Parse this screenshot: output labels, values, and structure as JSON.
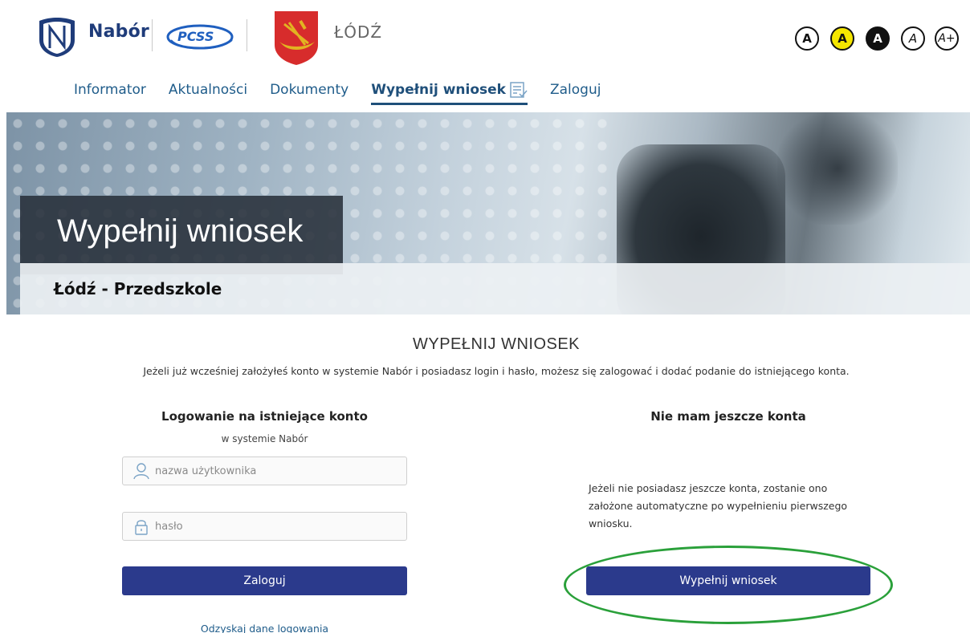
{
  "header": {
    "brand": "Nabór",
    "pcss_label": "PCSS",
    "city": "ŁÓDŹ",
    "a11y_buttons": [
      "A",
      "A",
      "A",
      "A",
      "A+"
    ]
  },
  "nav": {
    "items": [
      {
        "label": "Informator"
      },
      {
        "label": "Aktualności"
      },
      {
        "label": "Dokumenty"
      },
      {
        "label": "Wypełnij wniosek"
      },
      {
        "label": "Zaloguj"
      }
    ]
  },
  "banner": {
    "title": "Wypełnij wniosek",
    "subtitle": "Łódź - Przedszkole"
  },
  "main": {
    "heading": "WYPEŁNIJ WNIOSEK",
    "intro": "Jeżeli już wcześniej założyłeś konto w systemie Nabór i posiadasz login i hasło, możesz się zalogować i dodać podanie do istniejącego konta.",
    "login": {
      "title": "Logowanie na istniejące konto",
      "subtitle": "w systemie Nabór",
      "username_placeholder": "nazwa użytkownika",
      "password_placeholder": "hasło",
      "button": "Zaloguj",
      "recover_link": "Odzyskaj dane logowania"
    },
    "no_account": {
      "title": "Nie mam jeszcze konta",
      "text": "Jeżeli nie posiadasz jeszcze konta, zostanie ono założone automatyczne po wypełnieniu pierwszego wniosku.",
      "button": "Wypełnij wniosek"
    }
  },
  "colors": {
    "primary_button": "#2b3a8c",
    "nav_link": "#1f5c8a",
    "highlight_ellipse": "#2aa03a",
    "a11y_yellow": "#f5e600"
  }
}
